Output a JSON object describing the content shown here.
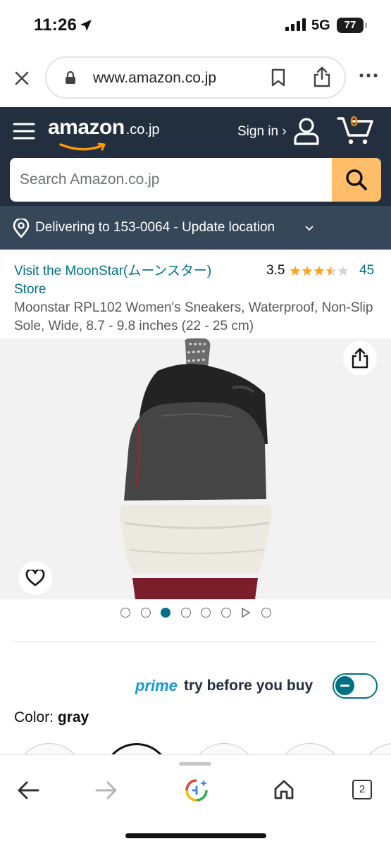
{
  "status_bar": {
    "time": "11:26",
    "network": "5G",
    "battery": "77"
  },
  "browser": {
    "url": "www.amazon.co.jp",
    "tab_count": "2"
  },
  "header": {
    "logo_main": "amazon",
    "logo_tld": ".co.jp",
    "sign_in": "Sign in ›",
    "cart_count": "0",
    "search_placeholder": "Search Amazon.co.jp"
  },
  "delivery": {
    "text": "Delivering to 153-0064 - Update location"
  },
  "product": {
    "store_link": "Visit the MoonStar(ムーンスター) Store",
    "rating": "3.5",
    "rating_value": 3.5,
    "rating_count": "45",
    "title": "Moonstar RPL102 Women's Sneakers, Waterproof, Non-Slip Sole, Wide, 8.7 - 9.8 inches (22 - 25 cm)",
    "image_pager": {
      "total": 8,
      "active_index": 2,
      "video_index": 6
    }
  },
  "prime": {
    "brand": "prime",
    "tagline": "try before you buy",
    "toggle_state": "off"
  },
  "color": {
    "label": "Color:",
    "value": "gray"
  },
  "colors_theme": {
    "header_bg": "#232f3e",
    "delivery_bg": "#37475a",
    "link": "#007185",
    "search_button": "#febd69",
    "prime_blue": "#1399d6",
    "star": "#ffa41c"
  }
}
